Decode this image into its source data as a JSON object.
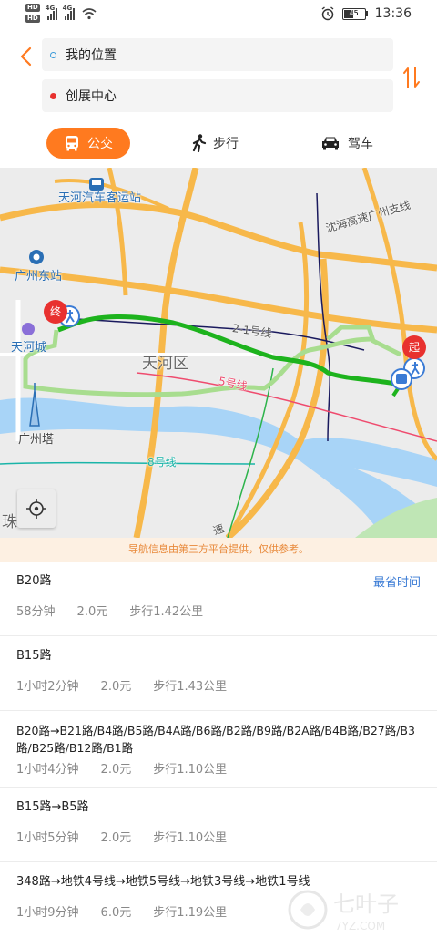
{
  "status_bar": {
    "time": "13:36",
    "battery": "45",
    "network_a": "4G",
    "network_b": "4G",
    "hd": "HD"
  },
  "search": {
    "origin": "我的位置",
    "destination": "创展中心"
  },
  "modes": [
    {
      "label": "公交",
      "icon": "bus-icon"
    },
    {
      "label": "步行",
      "icon": "walk-icon"
    },
    {
      "label": "驾车",
      "icon": "car-icon"
    }
  ],
  "map": {
    "labels": {
      "bus_station": "天河汽车客运站",
      "east_station": "广州东站",
      "tianhe_city": "天河城",
      "district": "天河区",
      "tower": "广州塔",
      "zhu": "珠",
      "expressway": "沈海高速广州支线",
      "metro_21": "2-1号线",
      "metro_5": "5号线",
      "metro_8": "8号线",
      "road": "速"
    },
    "markers": {
      "end": "终",
      "start": "起"
    }
  },
  "notice": "导航信息由第三方平台提供，仅供参考。",
  "routes": [
    {
      "title": "B20路",
      "time": "58分钟",
      "price": "2.0元",
      "walk": "步行1.42公里",
      "tag": "最省时间"
    },
    {
      "title": "B15路",
      "time": "1小时2分钟",
      "price": "2.0元",
      "walk": "步行1.43公里"
    },
    {
      "title": "B20路→B21路/B4路/B5路/B4A路/B6路/B2路/B9路/B2A路/B4B路/B27路/B3路/B25路/B12路/B1路",
      "time": "1小时4分钟",
      "price": "2.0元",
      "walk": "步行1.10公里"
    },
    {
      "title": "B15路→B5路",
      "time": "1小时5分钟",
      "price": "2.0元",
      "walk": "步行1.10公里"
    },
    {
      "title": "348路→地铁4号线→地铁5号线→地铁3号线→地铁1号线",
      "time": "1小时9分钟",
      "price": "6.0元",
      "walk": "步行1.19公里"
    }
  ],
  "watermark": {
    "name": "七叶子",
    "site": "7YZ.COM"
  },
  "colors": {
    "accent": "#ff7a1f",
    "route_green": "#1db31d",
    "link_blue": "#3a7bd5",
    "notice_bg": "#fdf0e2"
  }
}
